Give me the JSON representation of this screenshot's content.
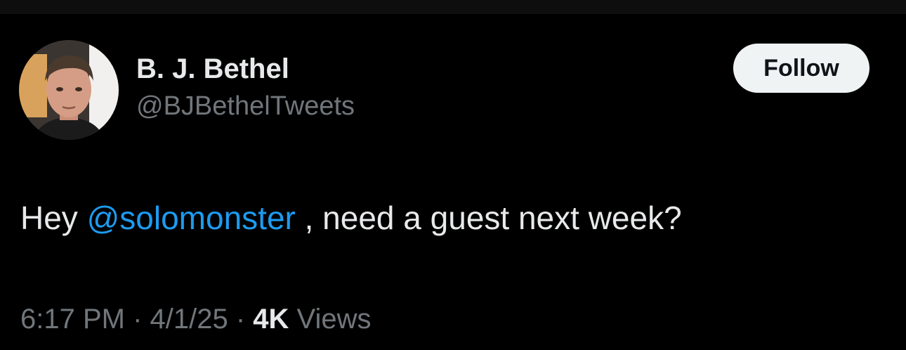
{
  "tweet": {
    "author": {
      "display_name": "B. J. Bethel",
      "handle": "@BJBethelTweets"
    },
    "follow_label": "Follow",
    "text": {
      "prefix": "Hey ",
      "mention": "@solomonster",
      "suffix": " , need a guest next week?"
    },
    "meta": {
      "time": "6:17 PM",
      "separator": " · ",
      "date": "4/1/25",
      "views_count": "4K",
      "views_label": " Views"
    }
  },
  "colors": {
    "background": "#000000",
    "primary_text": "#e7e9ea",
    "secondary_text": "#71767b",
    "mention": "#1d9bf0",
    "follow_button_bg": "#eff3f4",
    "follow_button_text": "#0f1419"
  },
  "icons": {
    "avatar": "user-avatar-photo"
  }
}
